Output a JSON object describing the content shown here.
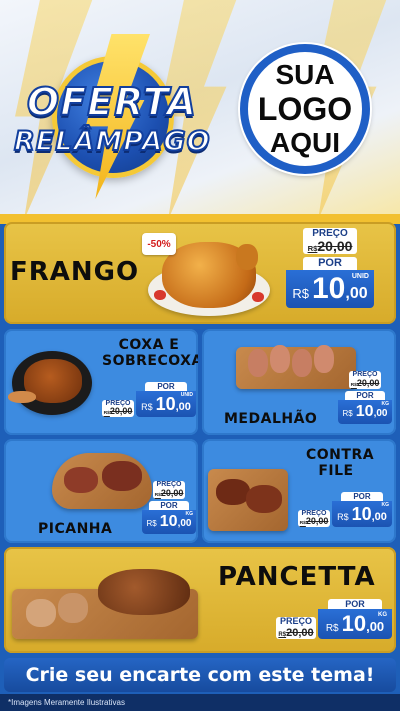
{
  "header": {
    "promo_line1": "OFERTA",
    "promo_line2": "RELÂMPAGO",
    "logo_line1": "SUA",
    "logo_line2": "LOGO",
    "logo_line3": "AQUI"
  },
  "colors": {
    "accent_gold": "#e8c447",
    "card_blue": "#3d8be0",
    "price_blue": "#1b53b2",
    "background_blue": "#1e5fb8"
  },
  "products": {
    "frango": {
      "name": "FRANGO",
      "discount": "-50%",
      "preco_label": "PREÇO",
      "old_currency": "R$",
      "old_price": "20,00",
      "por_label": "POR",
      "currency": "R$",
      "price_int": "10",
      "price_cents": ",00",
      "unit": "UNID"
    },
    "coxa": {
      "name_line1": "COXA E",
      "name_line2": "SOBRECOXA",
      "preco_label": "PREÇO",
      "old_currency": "R$",
      "old_price": "20,00",
      "por_label": "POR",
      "currency": "R$",
      "price_int": "10",
      "price_cents": ",00",
      "unit": "UNID"
    },
    "medalhao": {
      "name": "MEDALHÃO",
      "preco_label": "PREÇO",
      "old_currency": "R$",
      "old_price": "20,00",
      "por_label": "POR",
      "currency": "R$",
      "price_int": "10",
      "price_cents": ",00",
      "unit": "KG"
    },
    "picanha": {
      "name": "PICANHA",
      "preco_label": "PREÇO",
      "old_currency": "R$",
      "old_price": "20,00",
      "por_label": "POR",
      "currency": "R$",
      "price_int": "10",
      "price_cents": ",00",
      "unit": "KG"
    },
    "contrafile": {
      "name_line1": "CONTRA",
      "name_line2": "FILE",
      "preco_label": "PREÇO",
      "old_currency": "R$",
      "old_price": "20,00",
      "por_label": "POR",
      "currency": "R$",
      "price_int": "10",
      "price_cents": ",00",
      "unit": "KG"
    },
    "pancetta": {
      "name": "PANCETTA",
      "preco_label": "PREÇO",
      "old_currency": "R$",
      "old_price": "20,00",
      "por_label": "POR",
      "currency": "R$",
      "price_int": "10",
      "price_cents": ",00",
      "unit": "KG"
    }
  },
  "cta": {
    "label": "Crie seu encarte com este tema!"
  },
  "footer": {
    "note": "*Imagens Meramente Ilustrativas"
  }
}
